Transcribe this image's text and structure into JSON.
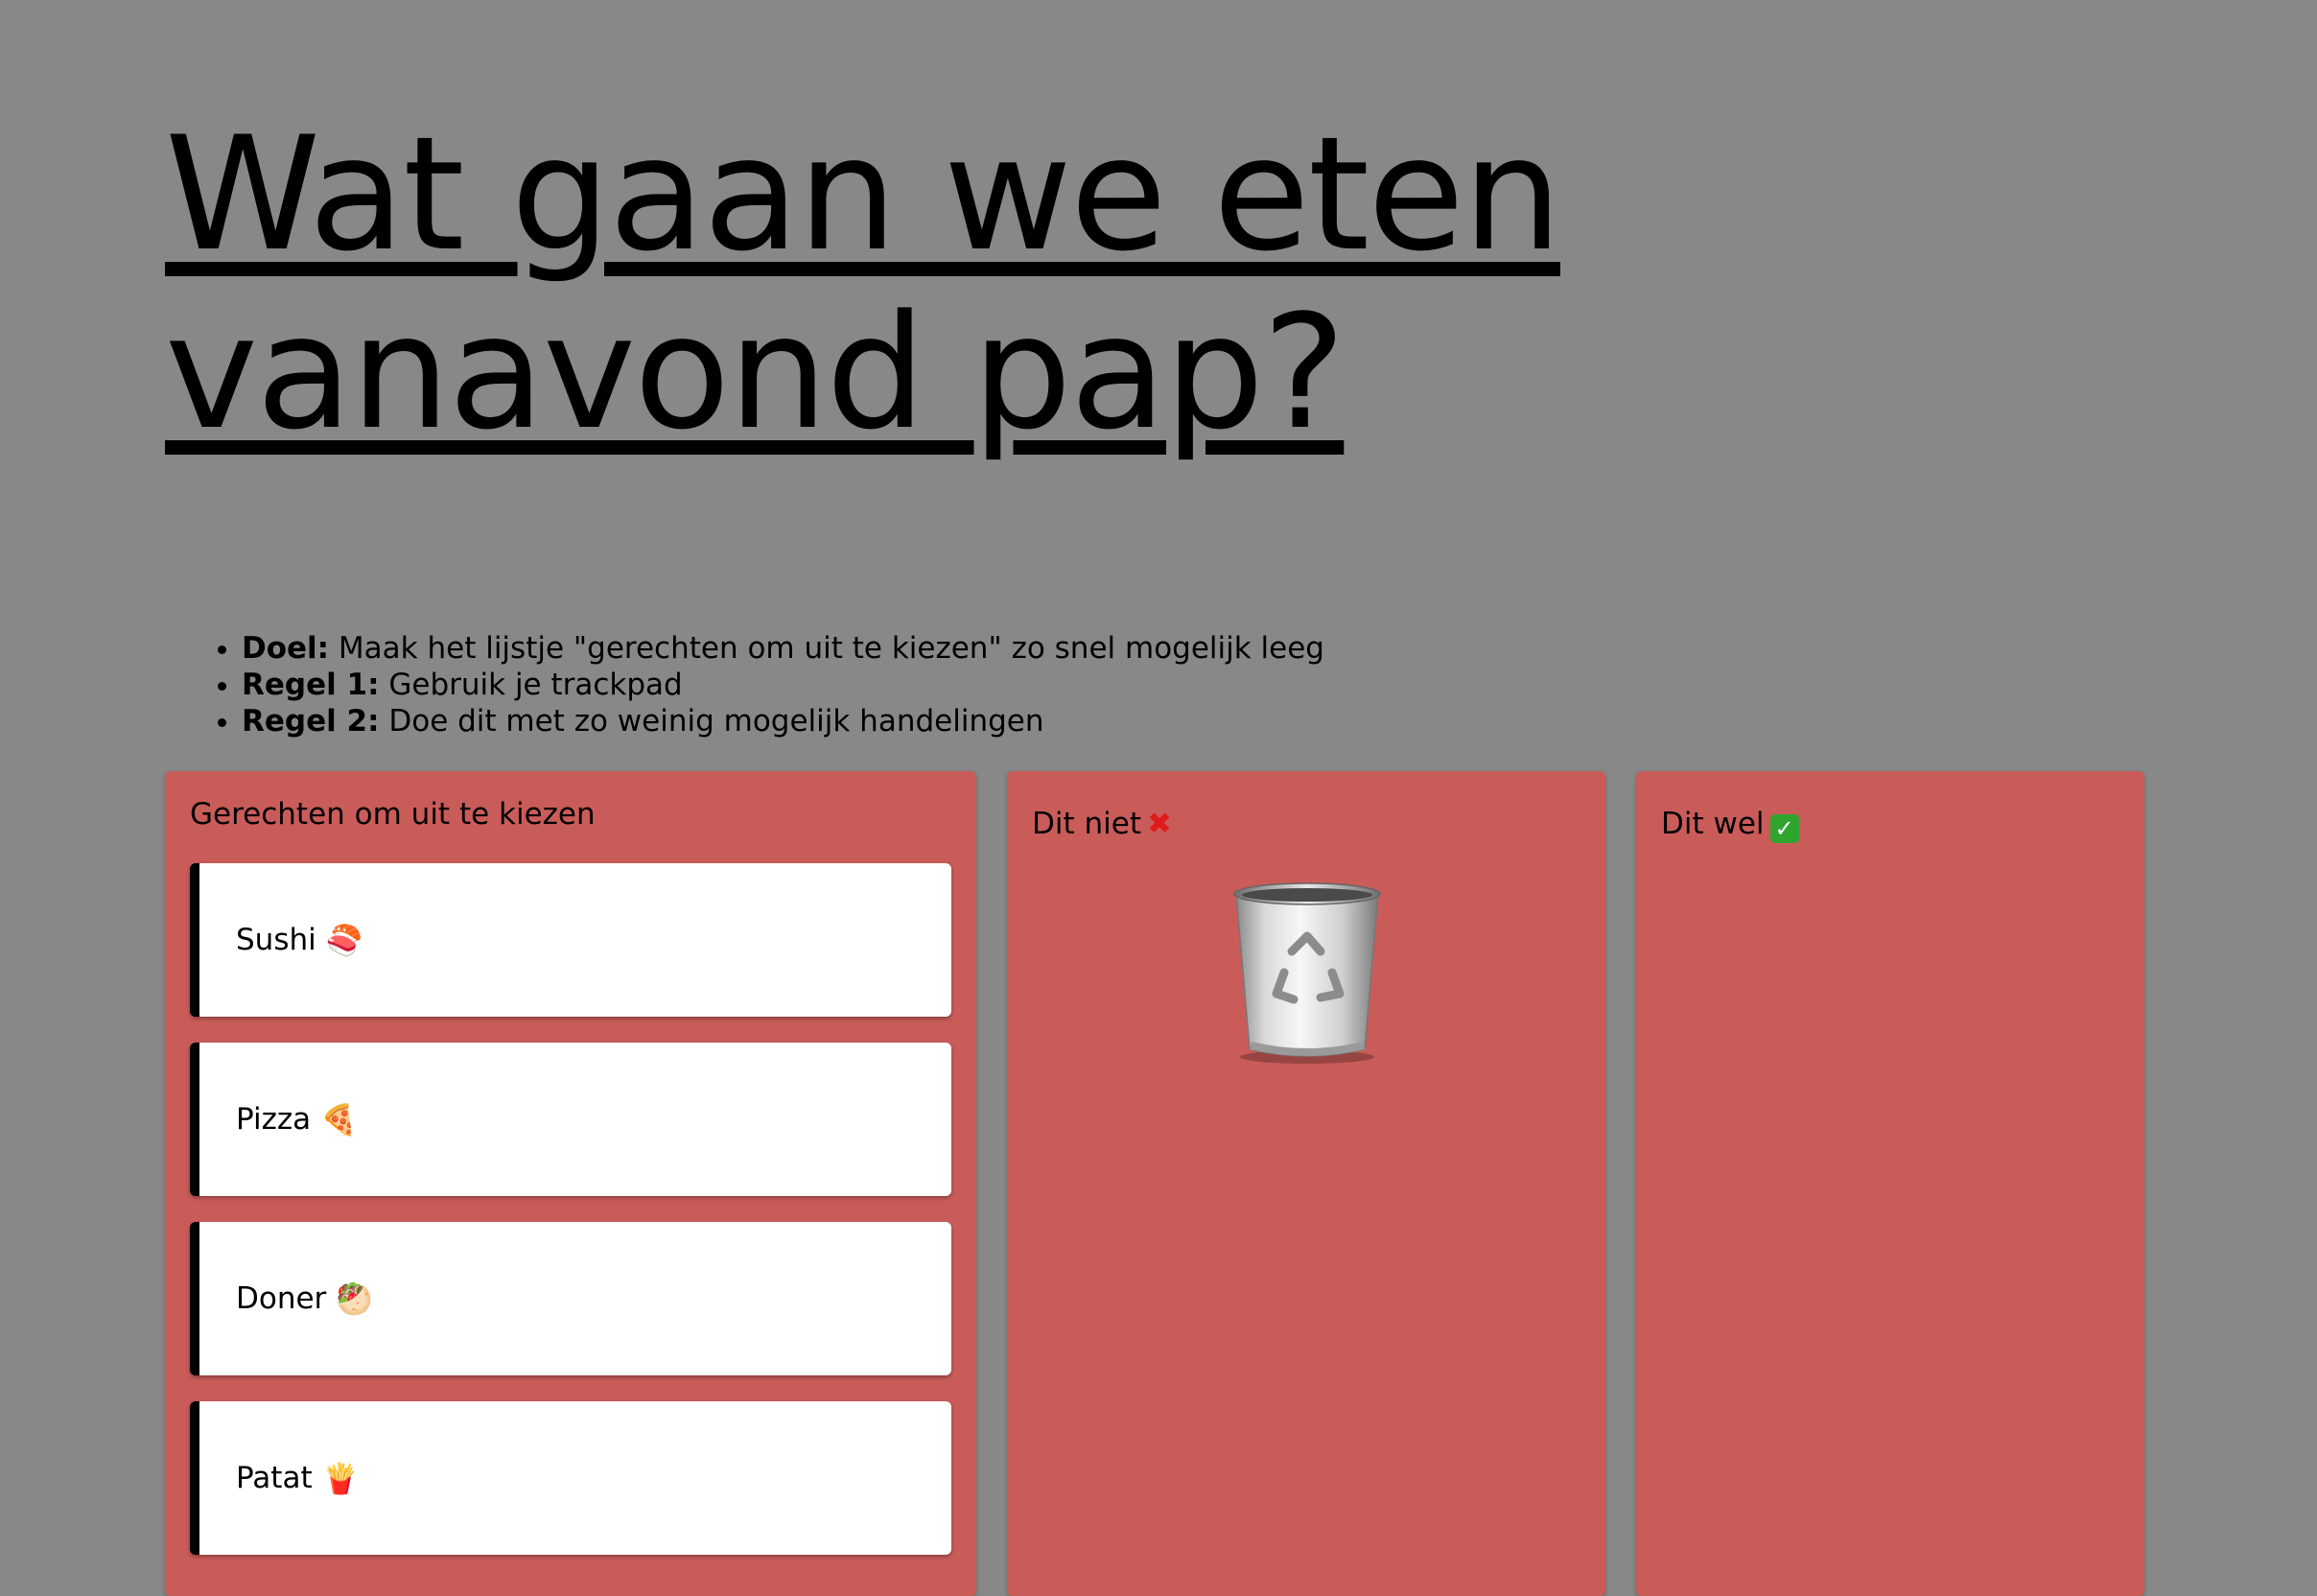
{
  "title": "Wat gaan we eten vanavond pap?",
  "rules": [
    {
      "label": "Doel:",
      "text": " Maak het lijstje \"gerechten om uit te kiezen\" zo snel mogelijk leeg"
    },
    {
      "label": "Regel 1:",
      "text": " Gebruik je trackpad"
    },
    {
      "label": "Regel 2:",
      "text": " Doe dit met zo weinig mogelijk handelingen"
    }
  ],
  "columns": {
    "choose": {
      "heading": "Gerechten om uit te kiezen",
      "items": [
        {
          "label": "Sushi",
          "emoji": "🍣"
        },
        {
          "label": "Pizza",
          "emoji": "🍕"
        },
        {
          "label": "Doner",
          "emoji": "🥙"
        },
        {
          "label": "Patat",
          "emoji": "🍟"
        }
      ]
    },
    "not": {
      "heading": "Dit niet",
      "mark": "✖",
      "icon": "trash-can-icon"
    },
    "yes": {
      "heading": "Dit wel",
      "mark": "✓"
    }
  },
  "colors": {
    "background": "#888888",
    "column": "#c95c59",
    "card": "#ffffff"
  }
}
